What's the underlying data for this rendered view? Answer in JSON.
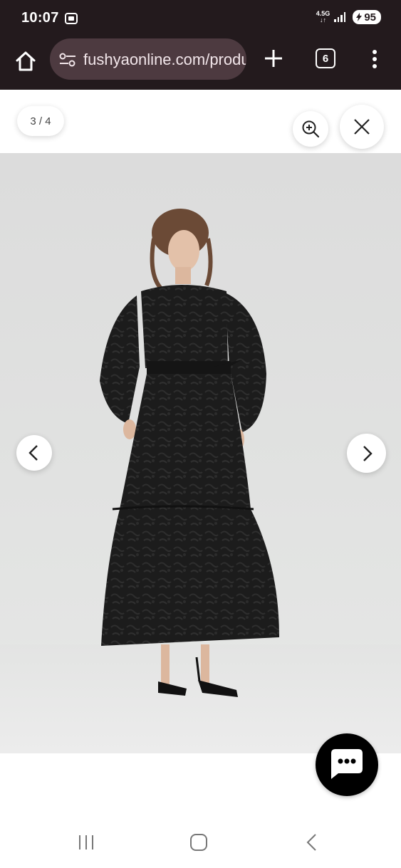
{
  "status_bar": {
    "time": "10:07",
    "network": "4.5G",
    "battery": "95"
  },
  "browser": {
    "url": "fushyaonline.com/products/",
    "tab_count": "6"
  },
  "gallery": {
    "counter": "3 / 4"
  },
  "icons": {
    "home": "home-icon",
    "site_settings": "tune-icon",
    "new_tab": "plus-icon",
    "menu": "more-vert-icon",
    "zoom": "zoom-in-icon",
    "close": "close-icon",
    "prev": "chevron-left-icon",
    "next": "chevron-right-icon",
    "chat": "chat-bubble-icon"
  },
  "colors": {
    "chrome_bg": "#231a1d",
    "url_pill_bg": "#4d3a40",
    "chat_bg": "#000000"
  }
}
